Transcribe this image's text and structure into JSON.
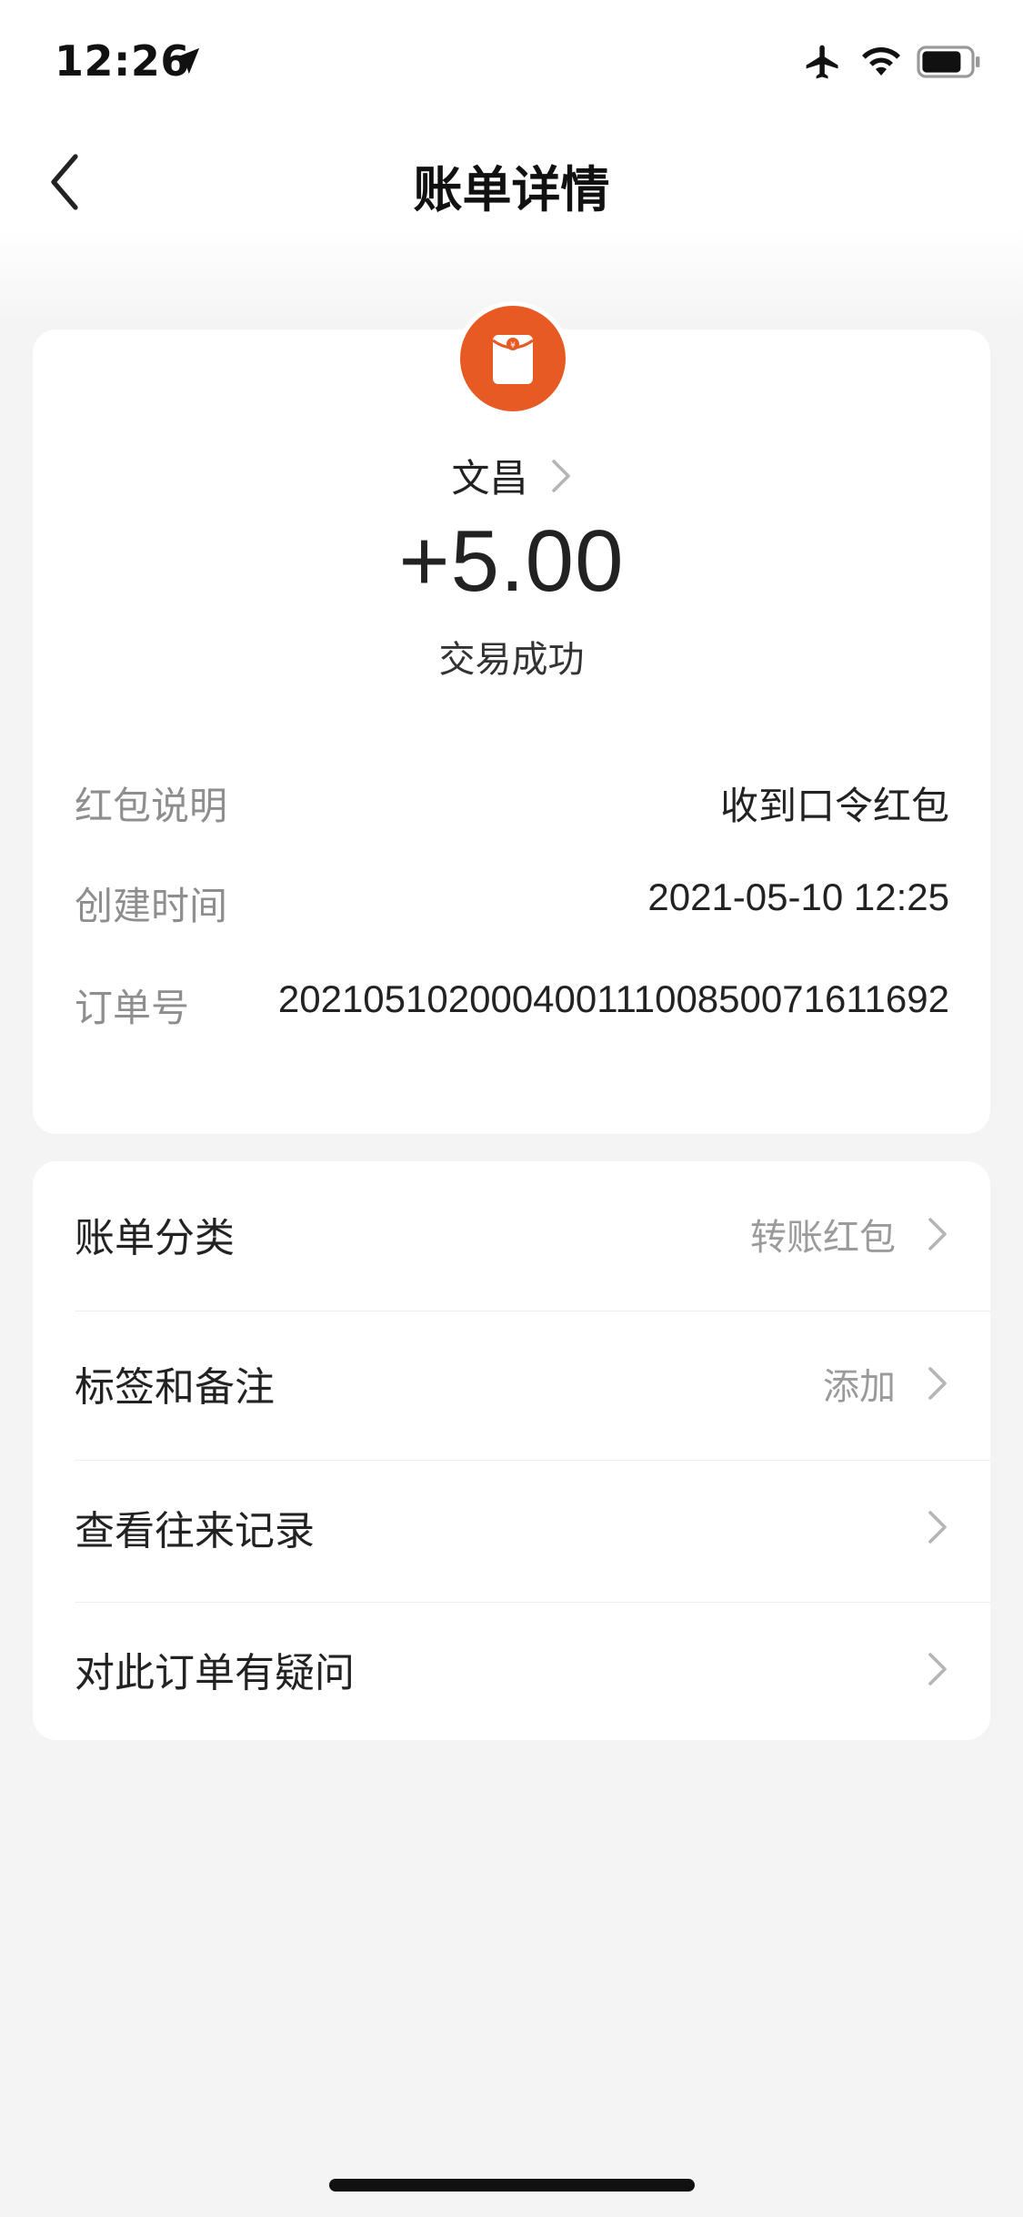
{
  "status_bar": {
    "time": "12:26"
  },
  "nav": {
    "title": "账单详情"
  },
  "summary": {
    "payer_name": "文昌",
    "amount": "+5.00",
    "status": "交易成功"
  },
  "details": [
    {
      "label": "红包说明",
      "value": "收到口令红包"
    },
    {
      "label": "创建时间",
      "value": "2021-05-10 12:25"
    },
    {
      "label": "订单号",
      "value": "2021051020004001110085007161169 2"
    }
  ],
  "order_number": "20210510200040011100850071611692",
  "menu": [
    {
      "label": "账单分类",
      "value": "转账红包"
    },
    {
      "label": "标签和备注",
      "value": "添加"
    },
    {
      "label": "查看往来记录",
      "value": ""
    },
    {
      "label": "对此订单有疑问",
      "value": ""
    }
  ],
  "colors": {
    "accent": "#e85a23",
    "background": "#f4f4f4",
    "card": "#ffffff",
    "label_gray": "#8e8e8e"
  },
  "icons": {
    "back": "chevron-left-icon",
    "avatar": "red-envelope-icon",
    "chevron": "chevron-right-icon"
  }
}
